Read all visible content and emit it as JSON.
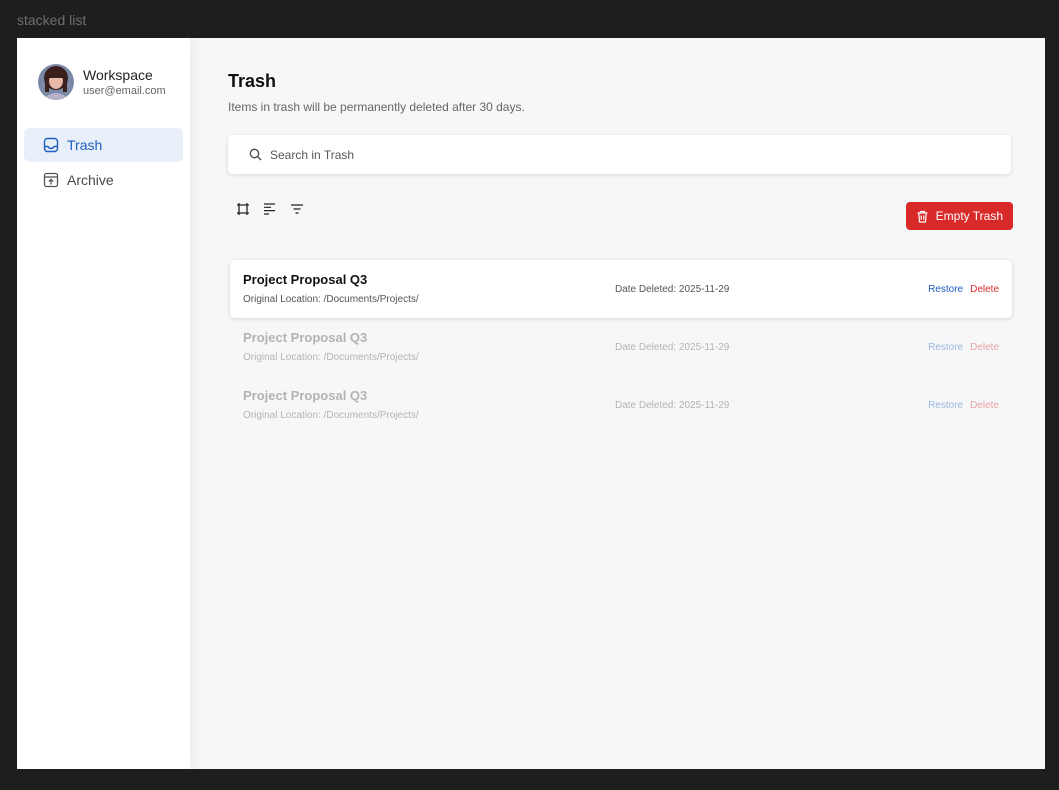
{
  "frame": {
    "label": "stacked list"
  },
  "sidebar": {
    "workspace_name": "Workspace",
    "user_email": "user@email.com",
    "items": [
      {
        "label": "Trash",
        "icon": "inbox-icon",
        "active": true
      },
      {
        "label": "Archive",
        "icon": "archive-icon",
        "active": false
      }
    ]
  },
  "main": {
    "title": "Trash",
    "subtitle": "Items in trash will be permanently deleted after 30 days.",
    "search_placeholder": "Search in Trash",
    "empty_button_label": "Empty Trash",
    "items": [
      {
        "name": "Project Proposal Q3",
        "location": "Original Location: /Documents/Projects/",
        "date": "Date Deleted: 2025-11-29",
        "restore_label": "Restore",
        "delete_label": "Delete"
      },
      {
        "name": "Project Proposal Q3",
        "location": "Original Location: /Documents/Projects/",
        "date": "Date Deleted: 2025-11-29",
        "restore_label": "Restore",
        "delete_label": "Delete"
      },
      {
        "name": "Project Proposal Q3",
        "location": "Original Location: /Documents/Projects/",
        "date": "Date Deleted: 2025-11-29",
        "restore_label": "Restore",
        "delete_label": "Delete"
      }
    ]
  },
  "colors": {
    "accent_blue": "#1d5fbf",
    "danger_red": "#d92a2a",
    "active_nav_bg": "#e9eff8"
  }
}
